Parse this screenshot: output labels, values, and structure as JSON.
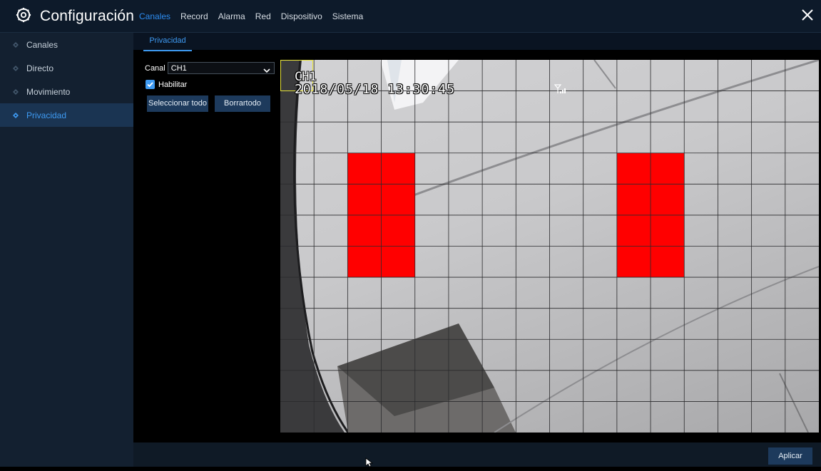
{
  "header": {
    "title": "Configuración",
    "tabs": [
      {
        "label": "Canales",
        "active": true
      },
      {
        "label": "Record"
      },
      {
        "label": "Alarma"
      },
      {
        "label": "Red"
      },
      {
        "label": "Dispositivo"
      },
      {
        "label": "Sistema"
      }
    ],
    "icons": {
      "settings": "gear-icon",
      "close": "close-icon"
    }
  },
  "sidebar": {
    "items": [
      {
        "label": "Canales"
      },
      {
        "label": "Directo"
      },
      {
        "label": "Movimiento"
      },
      {
        "label": "Privacidad",
        "active": true
      }
    ]
  },
  "subtabs": [
    {
      "label": "Privacidad",
      "active": true
    }
  ],
  "controls": {
    "canal_label": "Canal",
    "canal_value": "CH1",
    "habilitar_label": "Habilitar",
    "habilitar_checked": true,
    "select_all_label": "Seleccionar todo",
    "clear_all_label": "Borrartodo"
  },
  "video": {
    "osd_channel": "CH1",
    "osd_timestamp": "2018/05/18 13:30:45",
    "grid": {
      "columns": 16,
      "rows": 12
    },
    "privacy_zones": [
      {
        "col_start": 2,
        "col_end": 3,
        "row_start": 3,
        "row_end": 6
      },
      {
        "col_start": 10,
        "col_end": 11,
        "row_start": 3,
        "row_end": 6
      }
    ]
  },
  "footer": {
    "apply_label": "Aplicar"
  },
  "colors": {
    "accent": "#3e9af2",
    "privacy_mask": "#ff0000",
    "topbar_bg": "#0d1a2a",
    "sidebar_bg": "#132030",
    "button_bg": "#1d3a5c"
  }
}
